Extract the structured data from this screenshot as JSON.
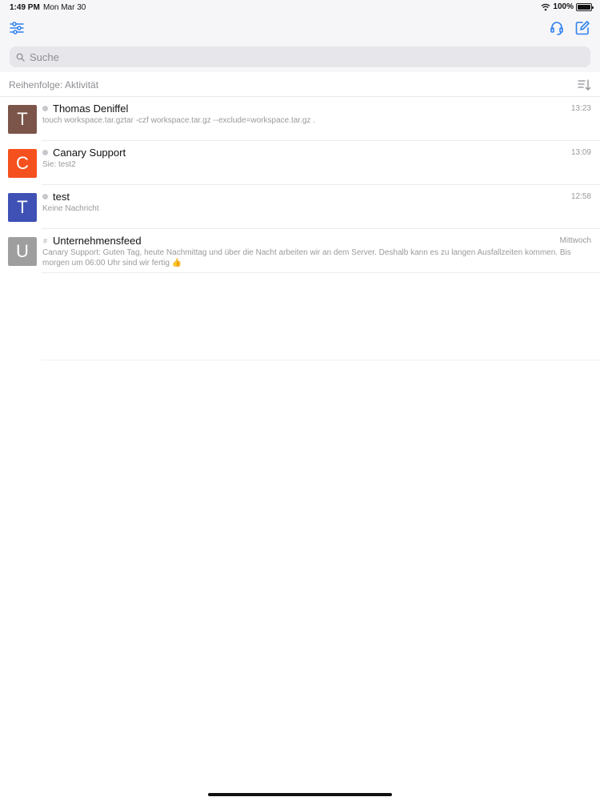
{
  "status": {
    "time": "1:49 PM",
    "date": "Mon Mar 30",
    "battery": "100%"
  },
  "search": {
    "placeholder": "Suche"
  },
  "sort": {
    "label": "Reihenfolge: Aktivität"
  },
  "colors": {
    "accent": "#2f80ed"
  },
  "rooms": [
    {
      "initial": "T",
      "name": "Thomas Deniffel",
      "time": "13:23",
      "preview": "touch workspace.tar.gztar -czf workspace.tar.gz --exclude=workspace.tar.gz .",
      "color": "#7b5549",
      "type": "dm"
    },
    {
      "initial": "C",
      "name": "Canary Support",
      "time": "13:09",
      "preview": "Sie: test2",
      "color": "#f4511e",
      "type": "dm"
    },
    {
      "initial": "T",
      "name": "test",
      "time": "12:58",
      "preview": "Keine Nachricht",
      "color": "#3f51b5",
      "type": "dm"
    },
    {
      "initial": "U",
      "name": "Unternehmensfeed",
      "time": "Mittwoch",
      "preview": "Canary Support: Guten Tag, heute Nachmittag und über die Nacht arbeiten wir an dem Server. Deshalb kann es zu langen Ausfallzeiten kommen. Bis morgen um 06:00 Uhr sind wir fertig 👍",
      "color": "#9e9e9e",
      "type": "channel",
      "channel_icon": "#"
    }
  ]
}
